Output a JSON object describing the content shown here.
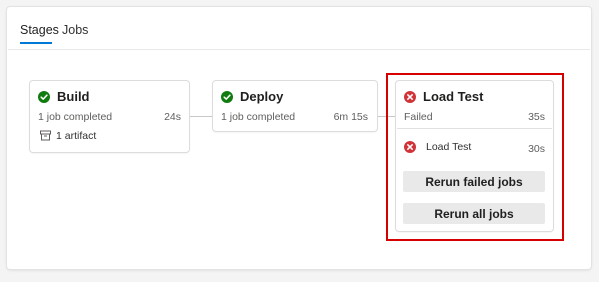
{
  "tabs": [
    {
      "label": "Stages",
      "active": true
    },
    {
      "label": "Jobs",
      "active": false
    }
  ],
  "stages": [
    {
      "name": "Build",
      "status": "succeeded",
      "summary": "1 job completed",
      "duration": "24s",
      "artifact": "1 artifact"
    },
    {
      "name": "Deploy",
      "status": "succeeded",
      "summary": "1 job completed",
      "duration": "6m 15s"
    },
    {
      "name": "Load Test",
      "status": "failed",
      "summary": "Failed",
      "duration": "35s",
      "jobs": [
        {
          "name": "Load Test",
          "status": "failed",
          "duration": "30s"
        }
      ]
    }
  ],
  "actions": {
    "rerun_failed": "Rerun failed jobs",
    "rerun_all": "Rerun all jobs"
  },
  "colors": {
    "success": "#107c10",
    "failed": "#d13438",
    "accent": "#0078d4",
    "annotation": "#d60000"
  },
  "icons": {
    "success": "check-circle-icon",
    "failed": "error-circle-icon",
    "artifact": "artifact-icon"
  }
}
